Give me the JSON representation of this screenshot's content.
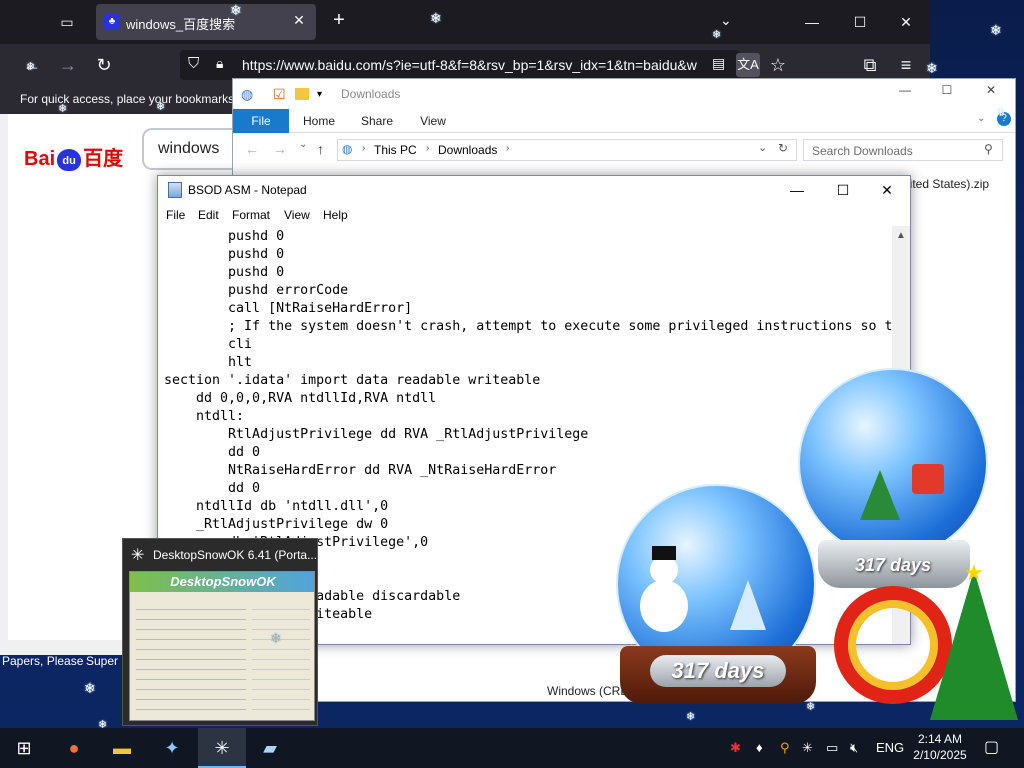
{
  "browser": {
    "tab_title": "windows_百度搜索",
    "url": "https://www.baidu.com/s?ie=utf-8&f=8&rsv_bp=1&rsv_idx=1&tn=baidu&w",
    "bookmarks_message": "For quick access, place your bookmarks",
    "content": {
      "logo_text_1": "Bai",
      "logo_paw": "du",
      "logo_text_2": "百度",
      "search_value": "windows"
    },
    "tab_snippets": [
      "Papers, Please",
      "Super I"
    ]
  },
  "explorer": {
    "title": "Downloads",
    "ribbon_tabs": [
      "File",
      "Home",
      "Share",
      "View"
    ],
    "path": [
      "This PC",
      "Downloads"
    ],
    "search_placeholder": "Search Downloads",
    "file_snippet": "nited States).zip",
    "status_snippet": "Windows (CRE"
  },
  "notepad": {
    "title": "BSOD ASM - Notepad",
    "menu": [
      "File",
      "Edit",
      "Format",
      "View",
      "Help"
    ],
    "code": "        pushd 0\n        pushd 0\n        pushd 0\n        pushd errorCode\n        call [NtRaiseHardError]\n        ; If the system doesn't crash, attempt to execute some privileged instructions so t\n        cli\n        hlt\nsection '.idata' import data readable writeable\n    dd 0,0,0,RVA ntdllId,RVA ntdll\n    ntdll:\n        RtlAdjustPrivilege dd RVA _RtlAdjustPrivilege\n        dd 0\n        NtRaiseHardError dd RVA _NtRaiseHardError\n        dd 0\n    ntdllId db 'ntdll.dll',0\n    _RtlAdjustPrivilege dw 0\n        db 'RtlAdjustPrivilege',0\n        or dw 0\n        ardError',0\n        ups data readable discardable\n        readable writeable"
  },
  "thumbnail": {
    "title": "DesktopSnowOK 6.41 (Porta...",
    "banner": "DesktopSnowOK"
  },
  "globes": {
    "big_label": "317 days",
    "small_label": "317 days"
  },
  "taskbar": {
    "items": [
      "start-icon",
      "firefox-icon",
      "file-explorer-icon",
      "app-icon",
      "desktopsnowok-icon",
      "notepad-icon"
    ],
    "tray_language": "ENG",
    "time": "2:14 AM",
    "date": "2/10/2025"
  }
}
